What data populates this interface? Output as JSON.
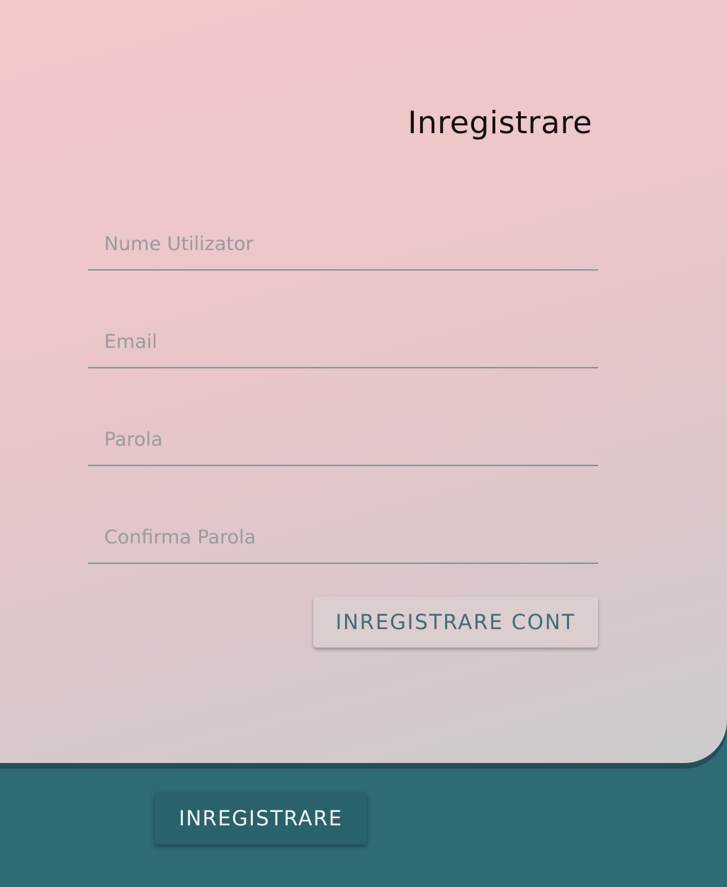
{
  "form": {
    "title": "Inregistrare",
    "fields": [
      {
        "placeholder": "Nume Utilizator",
        "value": ""
      },
      {
        "placeholder": "Email",
        "value": ""
      },
      {
        "placeholder": "Parola",
        "value": ""
      },
      {
        "placeholder": "Confirma Parola",
        "value": ""
      }
    ],
    "submit_label": "INREGISTRARE CONT"
  },
  "footer": {
    "button_label": "INREGISTRARE"
  },
  "colors": {
    "accent": "#2e6b75",
    "panel_top": "#f3c9c9",
    "panel_bottom": "#cccbcc",
    "placeholder": "#9a9b9d"
  }
}
